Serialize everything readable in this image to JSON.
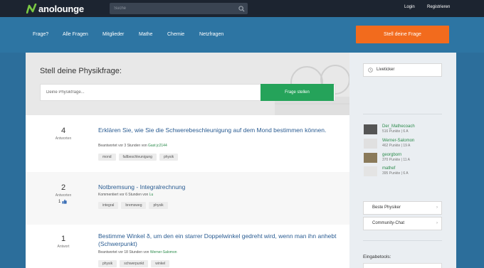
{
  "brand": {
    "logo_text": "anolounge"
  },
  "search": {
    "placeholder": "Suche"
  },
  "top_links": {
    "login": "Login",
    "register": "Registrieren"
  },
  "nav": [
    "Frage?",
    "Alle Fragen",
    "Mitglieder",
    "Mathe",
    "Chemie",
    "Netzfragen"
  ],
  "cta": {
    "label": "Stell deine Frage"
  },
  "hero": {
    "title": "Stell deine Physikfrage:",
    "input_placeholder": "Deine Physikfrage...",
    "button": "Frage stellen"
  },
  "questions": [
    {
      "count": "4",
      "count_label": "Antworten",
      "votes": "",
      "title": "Erklären Sie, wie Sie die Schwerebeschleunigung auf dem Mond bestimmen können.",
      "meta_prefix": "Beantwortet vor 3 Stunden von",
      "meta_user": "Gast jc2144",
      "tags": [
        "mond",
        "fallbeschleunigung",
        "physik"
      ]
    },
    {
      "count": "2",
      "count_label": "Antworten",
      "votes": "1",
      "title": "Notbremsung - Integralrechnung",
      "meta_prefix": "Kommentiert vor 6 Stunden von",
      "meta_user": "Lu",
      "tags": [
        "integral",
        "bremsweg",
        "physik"
      ]
    },
    {
      "count": "1",
      "count_label": "Antwort",
      "votes": "",
      "title": "Bestimme Winkel δ, um den ein starrer Doppelwinkel gedreht wird, wenn man ihn anhebt (Schwerpunkt)",
      "meta_prefix": "Beantwortet vor 18 Stunden von",
      "meta_user": "Werner-Salomon",
      "tags": [
        "physik",
        "schwerpunkt",
        "winkel"
      ]
    }
  ],
  "sidebar": {
    "liveticker": "Liveticker",
    "experts": [
      {
        "name": "Der_Mathecoach",
        "points": "516 Punkte | 6 A"
      },
      {
        "name": "Werner-Salomon",
        "points": "462 Punkte | 19 A"
      },
      {
        "name": "georgborn",
        "points": "370 Punkte | 11 A"
      },
      {
        "name": "mathef",
        "points": "395 Punkte | 6 A"
      }
    ],
    "best": "Beste Physiker",
    "chat": "Community-Chat",
    "eingabe": "Eingabetools:"
  },
  "colors": {
    "accent": "#f26b1d",
    "green": "#25a35a",
    "brand_blue": "#2d75a3"
  }
}
